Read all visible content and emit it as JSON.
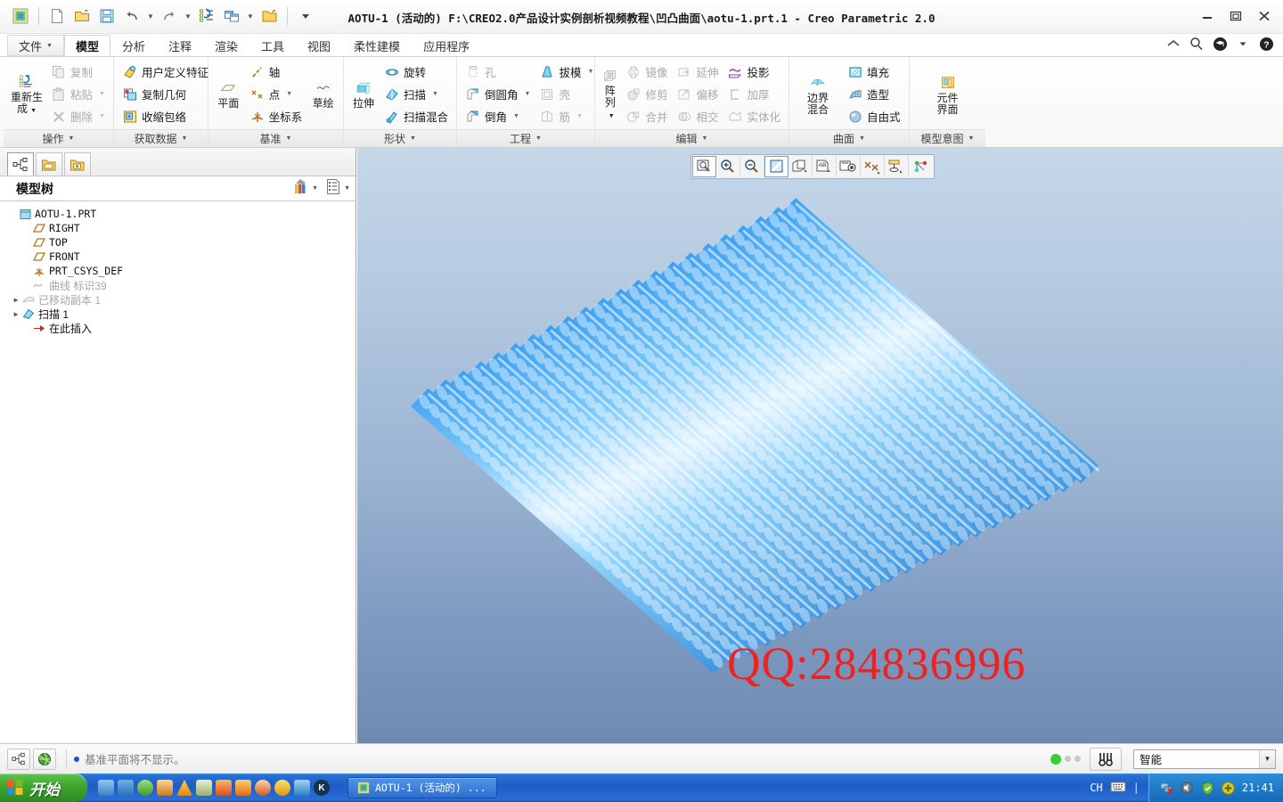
{
  "window": {
    "title": "AOTU-1  (活动的)  F:\\CREO2.0产品设计实例剖析视频教程\\凹凸曲面\\aotu-1.prt.1 - Creo Parametric 2.0",
    "minimize": "—",
    "maximize": "▭",
    "close": "✕"
  },
  "quick_access": {
    "items": [
      {
        "name": "creo-logo-icon",
        "label": ""
      },
      {
        "name": "new-file-icon",
        "label": ""
      },
      {
        "name": "open-file-icon",
        "label": ""
      },
      {
        "name": "save-icon",
        "label": ""
      },
      {
        "name": "undo-icon",
        "label": ""
      },
      {
        "name": "redo-icon",
        "label": ""
      },
      {
        "name": "regenerate-icon",
        "label": ""
      },
      {
        "name": "window-switch-icon",
        "label": ""
      },
      {
        "name": "open-folder-icon",
        "label": ""
      },
      {
        "name": "qat-overflow-icon",
        "label": ""
      }
    ]
  },
  "ribbon": {
    "tabs": [
      {
        "label": "文件",
        "has_caret": true,
        "active": false,
        "is_file": true
      },
      {
        "label": "模型",
        "has_caret": false,
        "active": true,
        "is_file": false
      },
      {
        "label": "分析",
        "has_caret": false,
        "active": false,
        "is_file": false
      },
      {
        "label": "注释",
        "has_caret": false,
        "active": false,
        "is_file": false
      },
      {
        "label": "渲染",
        "has_caret": false,
        "active": false,
        "is_file": false
      },
      {
        "label": "工具",
        "has_caret": false,
        "active": false,
        "is_file": false
      },
      {
        "label": "视图",
        "has_caret": false,
        "active": false,
        "is_file": false
      },
      {
        "label": "柔性建模",
        "has_caret": false,
        "active": false,
        "is_file": false
      },
      {
        "label": "应用程序",
        "has_caret": false,
        "active": false,
        "is_file": false
      }
    ],
    "help_icons": [
      {
        "name": "collapse-ribbon-icon"
      },
      {
        "name": "search-icon"
      },
      {
        "name": "graduation-cap-icon"
      },
      {
        "name": "help-icon"
      }
    ],
    "groups": [
      {
        "label": "操作",
        "big": {
          "label": "重新生\n成",
          "line1": "重新生",
          "line2": "成",
          "icon": "regenerate-big-icon",
          "caret": true
        },
        "columns": [
          {
            "items": [
              {
                "label": "复制",
                "icon": "copy-icon",
                "disabled": true,
                "caret": false
              },
              {
                "label": "粘贴",
                "icon": "paste-icon",
                "disabled": true,
                "caret": true
              },
              {
                "label": "删除",
                "icon": "delete-icon",
                "disabled": true,
                "caret": true
              }
            ]
          }
        ]
      },
      {
        "label": "获取数据",
        "columns": [
          {
            "items": [
              {
                "label": "用户定义特征",
                "icon": "udf-icon",
                "disabled": false,
                "caret": false
              },
              {
                "label": "复制几何",
                "icon": "copy-geom-icon",
                "disabled": false,
                "caret": false
              },
              {
                "label": "收缩包络",
                "icon": "shrinkwrap-icon",
                "disabled": false,
                "caret": false
              }
            ]
          }
        ]
      },
      {
        "label": "基准",
        "big": {
          "line1": "平面",
          "line2": "",
          "icon": "datum-plane-icon",
          "caret": false
        },
        "columns": [
          {
            "items": [
              {
                "label": "轴",
                "icon": "axis-icon",
                "disabled": false,
                "caret": false
              },
              {
                "label": "点",
                "icon": "point-icon",
                "disabled": false,
                "caret": true
              },
              {
                "label": "坐标系",
                "icon": "csys-icon",
                "disabled": false,
                "caret": false
              }
            ]
          }
        ],
        "big2": {
          "line1": "草绘",
          "line2": "",
          "icon": "sketch-icon",
          "caret": false
        }
      },
      {
        "label": "形状",
        "big": {
          "line1": "拉伸",
          "line2": "",
          "icon": "extrude-icon",
          "caret": false
        },
        "columns": [
          {
            "items": [
              {
                "label": "旋转",
                "icon": "revolve-icon",
                "disabled": false,
                "caret": false
              },
              {
                "label": "扫描",
                "icon": "sweep-icon",
                "disabled": false,
                "caret": true
              },
              {
                "label": "扫描混合",
                "icon": "swept-blend-icon",
                "disabled": false,
                "caret": false
              }
            ]
          }
        ]
      },
      {
        "label": "工程",
        "columns": [
          {
            "items": [
              {
                "label": "孔",
                "icon": "hole-icon",
                "disabled": true,
                "caret": false
              },
              {
                "label": "倒圆角",
                "icon": "round-icon",
                "disabled": false,
                "caret": true
              },
              {
                "label": "倒角",
                "icon": "chamfer-icon",
                "disabled": false,
                "caret": true
              }
            ]
          },
          {
            "items": [
              {
                "label": "拔模",
                "icon": "draft-icon",
                "disabled": false,
                "caret": true
              },
              {
                "label": "壳",
                "icon": "shell-icon",
                "disabled": true,
                "caret": false
              },
              {
                "label": "筋",
                "icon": "rib-icon",
                "disabled": true,
                "caret": true
              }
            ]
          }
        ]
      },
      {
        "label": "编辑",
        "big": {
          "line1": "阵列",
          "line2": "",
          "icon": "pattern-icon",
          "caret": true
        },
        "columns": [
          {
            "items": [
              {
                "label": "镜像",
                "icon": "mirror-icon",
                "disabled": true,
                "caret": false
              },
              {
                "label": "修剪",
                "icon": "trim-icon",
                "disabled": true,
                "caret": false
              },
              {
                "label": "合并",
                "icon": "merge-icon",
                "disabled": true,
                "caret": false
              }
            ]
          },
          {
            "items": [
              {
                "label": "延伸",
                "icon": "extend-icon",
                "disabled": true,
                "caret": false
              },
              {
                "label": "偏移",
                "icon": "offset-icon",
                "disabled": true,
                "caret": false
              },
              {
                "label": "相交",
                "icon": "intersect-icon",
                "disabled": true,
                "caret": false
              }
            ]
          },
          {
            "items": [
              {
                "label": "投影",
                "icon": "project-icon",
                "disabled": false,
                "caret": false
              },
              {
                "label": "加厚",
                "icon": "thicken-icon",
                "disabled": true,
                "caret": false
              },
              {
                "label": "实体化",
                "icon": "solidify-icon",
                "disabled": true,
                "caret": false
              }
            ]
          }
        ]
      },
      {
        "label": "曲面",
        "big": {
          "line1": "边界",
          "line2": "混合",
          "icon": "boundary-blend-icon",
          "caret": false
        },
        "columns": [
          {
            "items": [
              {
                "label": "填充",
                "icon": "fill-icon",
                "disabled": false,
                "caret": false
              },
              {
                "label": "造型",
                "icon": "style-icon",
                "disabled": false,
                "caret": false
              },
              {
                "label": "自由式",
                "icon": "freestyle-icon",
                "disabled": false,
                "caret": false
              }
            ]
          }
        ]
      },
      {
        "label": "模型意图",
        "big": {
          "line1": "元件",
          "line2": "界面",
          "icon": "component-interface-icon",
          "caret": false
        },
        "columns": []
      }
    ]
  },
  "tree_panel": {
    "tabs": [
      {
        "name": "model-tree-tab",
        "active": true
      },
      {
        "name": "folder-browser-tab",
        "active": false
      },
      {
        "name": "favorites-tab",
        "active": false
      }
    ],
    "title": "模型树",
    "header_buttons": [
      {
        "name": "tree-filter-icon",
        "caret": "▾"
      },
      {
        "name": "tree-settings-icon",
        "caret": "▾"
      }
    ],
    "nodes": [
      {
        "label": "AOTU-1.PRT",
        "icon": "part-icon",
        "indent": 0,
        "expander": "",
        "dim": false,
        "cjk": false
      },
      {
        "label": "RIGHT",
        "icon": "datum-plane-icon",
        "indent": 1,
        "expander": "",
        "dim": false,
        "cjk": false
      },
      {
        "label": "TOP",
        "icon": "datum-plane-icon",
        "indent": 1,
        "expander": "",
        "dim": false,
        "cjk": false
      },
      {
        "label": "FRONT",
        "icon": "datum-plane-icon",
        "indent": 1,
        "expander": "",
        "dim": false,
        "cjk": false
      },
      {
        "label": "PRT_CSYS_DEF",
        "icon": "csys-icon",
        "indent": 1,
        "expander": "",
        "dim": false,
        "cjk": false
      },
      {
        "label": "曲线 标识39",
        "icon": "curve-icon",
        "indent": 1,
        "expander": "",
        "dim": true,
        "cjk": true
      },
      {
        "label": "已移动副本 1",
        "icon": "moved-copy-icon",
        "indent": 1,
        "expander": "▶",
        "dim": true,
        "cjk": true
      },
      {
        "label": "扫描 1",
        "icon": "sweep-icon",
        "indent": 1,
        "expander": "▶",
        "dim": false,
        "cjk": true
      },
      {
        "label": "在此插入",
        "icon": "insert-here-icon",
        "indent": 1,
        "expander": "",
        "dim": false,
        "cjk": true
      }
    ]
  },
  "viewport": {
    "graphics_toolbar": [
      {
        "name": "refit-icon",
        "active": true
      },
      {
        "name": "zoom-in-icon",
        "active": false
      },
      {
        "name": "zoom-out-icon",
        "active": false
      },
      {
        "name": "repaint-icon",
        "active": true
      },
      {
        "name": "display-style-icon",
        "active": false
      },
      {
        "name": "annotation-display-icon",
        "active": false
      },
      {
        "name": "saved-view-icon",
        "active": false
      },
      {
        "name": "datum-display-icon",
        "active": false
      },
      {
        "name": "layer-display-icon",
        "active": false
      },
      {
        "name": "spin-center-icon",
        "active": false
      }
    ],
    "watermark": "QQ:284836996",
    "model_color": "#5bb4f5",
    "background_top": "#c6d7e9",
    "background_bottom": "#6e8ab0"
  },
  "statusbar": {
    "left_buttons": [
      {
        "name": "model-tree-toggle-icon"
      },
      {
        "name": "world-view-icon"
      }
    ],
    "message": "基准平面将不显示。",
    "selection_mode": "智能",
    "dropdown_caret": "▼",
    "find_button": "find-icon"
  },
  "taskbar": {
    "start_label": "开始",
    "quicklaunch": [
      {
        "name": "ql-media-icon"
      },
      {
        "name": "ql-browser-icon"
      },
      {
        "name": "ql-shield-icon"
      },
      {
        "name": "ql-app4-icon"
      },
      {
        "name": "ql-warn-icon"
      },
      {
        "name": "ql-leaf-icon"
      },
      {
        "name": "ql-app7-icon"
      },
      {
        "name": "ql-app8-icon"
      },
      {
        "name": "ql-qq-icon"
      },
      {
        "name": "ql-app10-icon"
      },
      {
        "name": "ql-app11-icon"
      },
      {
        "name": "ql-kugou-icon"
      }
    ],
    "task_item": "AOTU-1  (活动的) ...",
    "lang_indicator": "CH",
    "keyboard_icon": "keyboard-icon",
    "tray_icons": [
      {
        "name": "network-disconnected-icon"
      },
      {
        "name": "volume-icon"
      },
      {
        "name": "security-shield-icon"
      },
      {
        "name": "update-icon"
      }
    ],
    "clock": "21:41"
  }
}
